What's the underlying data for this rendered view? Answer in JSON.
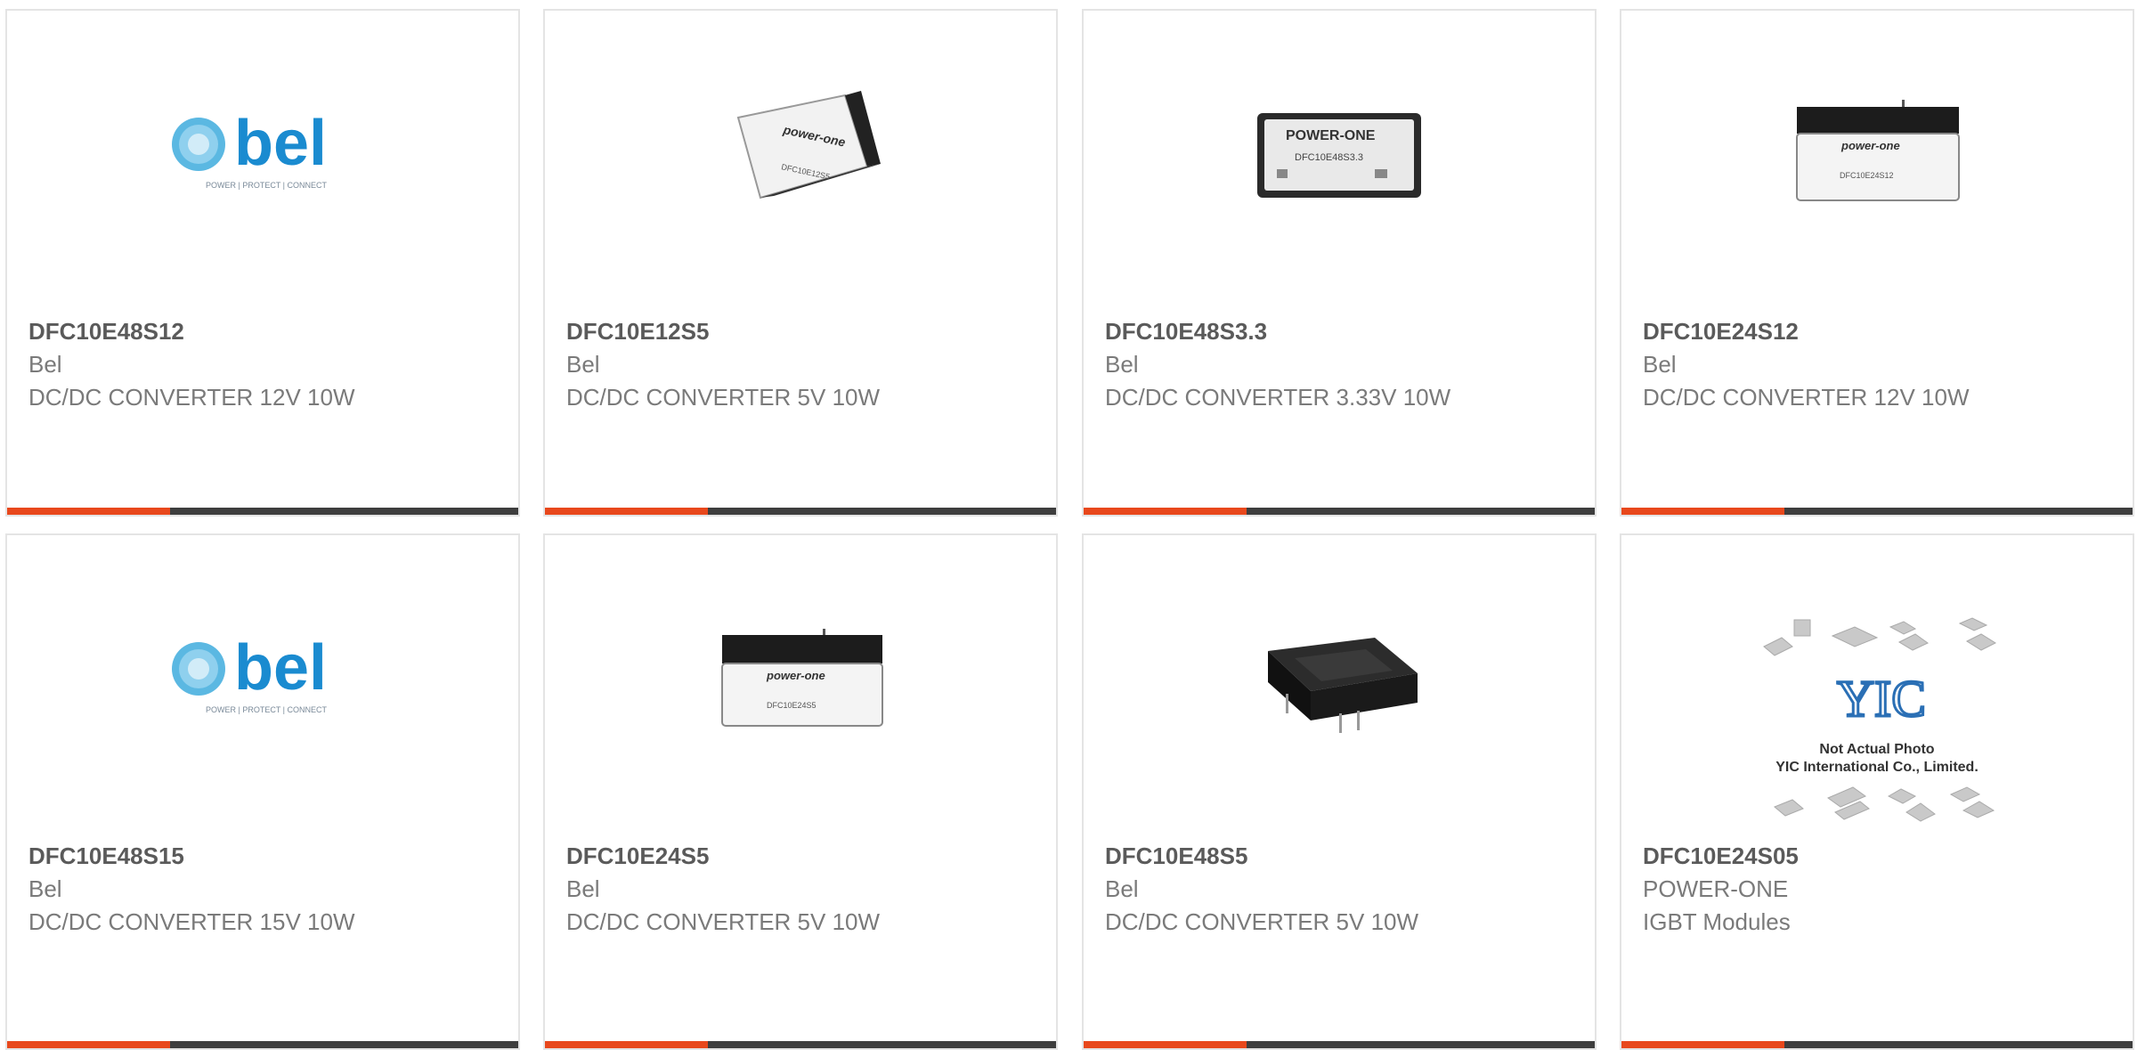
{
  "colors": {
    "accent": "#e8481c",
    "bar": "#3e3e3e",
    "border": "#e4e4e4"
  },
  "products": [
    {
      "part": "DFC10E48S12",
      "manufacturer": "Bel",
      "description": "DC/DC CONVERTER 12V 10W",
      "image": "bel-logo",
      "logo_text": "bel",
      "logo_tagline": "POWER | PROTECT | CONNECT"
    },
    {
      "part": "DFC10E12S5",
      "manufacturer": "Bel",
      "description": "DC/DC CONVERTER 5V 10W",
      "image": "module-angled",
      "module_brand": "power-one",
      "module_text": "DFC10E12S5"
    },
    {
      "part": "DFC10E48S3.3",
      "manufacturer": "Bel",
      "description": "DC/DC CONVERTER 3.33V 10W",
      "image": "module-top",
      "module_brand": "POWER-ONE",
      "module_text": "DFC10E48S3.3"
    },
    {
      "part": "DFC10E24S12",
      "manufacturer": "Bel",
      "description": "DC/DC CONVERTER 12V 10W",
      "image": "module-front",
      "module_brand": "power-one",
      "module_text": "DFC10E24S12"
    },
    {
      "part": "DFC10E48S15",
      "manufacturer": "Bel",
      "description": "DC/DC CONVERTER 15V 10W",
      "image": "bel-logo",
      "logo_text": "bel",
      "logo_tagline": "POWER | PROTECT | CONNECT"
    },
    {
      "part": "DFC10E24S5",
      "manufacturer": "Bel",
      "description": "DC/DC CONVERTER 5V 10W",
      "image": "module-front",
      "module_brand": "power-one",
      "module_text": "DFC10E24S5"
    },
    {
      "part": "DFC10E48S5",
      "manufacturer": "Bel",
      "description": "DC/DC CONVERTER 5V 10W",
      "image": "module-black",
      "module_brand": "",
      "module_text": ""
    },
    {
      "part": "DFC10E24S05",
      "manufacturer": "POWER-ONE",
      "description": "IGBT Modules",
      "image": "yic-placeholder",
      "placeholder_line1": "Not Actual Photo",
      "placeholder_line2": "YIC International Co., Limited."
    }
  ]
}
